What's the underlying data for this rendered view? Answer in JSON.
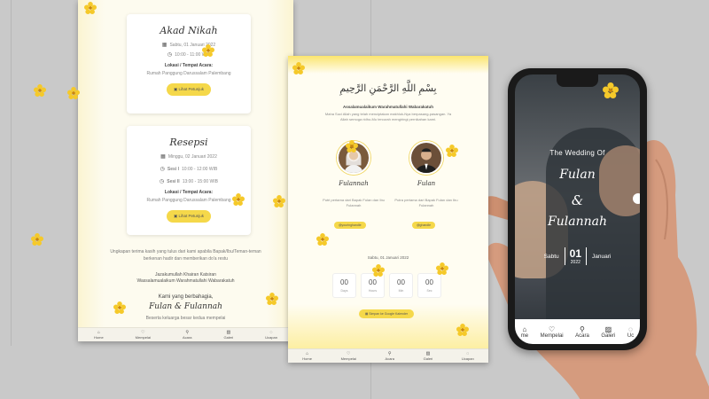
{
  "left": {
    "akad": {
      "title": "Akad Nikah",
      "date": "Sabtu, 01 Januari 2022",
      "time": "10:00 - 11:00 WIB",
      "venue_label": "Lokasi / Tempat Acara:",
      "venue": "Rumah Panggung Darussalam Palembang",
      "map_btn": "Lihat Petunjuk"
    },
    "resepsi": {
      "title": "Resepsi",
      "date": "Minggu, 02 Januari 2022",
      "sesi1_label": "Sesi I",
      "sesi1_time": "10:00 - 12:00 WIB",
      "sesi2_label": "Sesi II",
      "sesi2_time": "13:00 - 15:00 WIB",
      "venue_label": "Lokasi / Tempat Acara:",
      "venue": "Rumah Panggung Darussalam Palembang",
      "map_btn": "Lihat Petunjuk"
    },
    "closing_text": "Ungkapan terima kasih yang tulus dari kami apabila Bapak/Ibu/Teman-teman berkenan hadir dan memberikan do'a restu",
    "closing_salam_1": "Jazakumullah Khairan Katsiran",
    "closing_salam_2": "Wassalamualaikum Warahmatullahi Wabarakatuh",
    "we_are": "Kami yang berbahagia,",
    "couple": "Fulan & Fulannah",
    "families": "Beserta keluarga besar kedua mempelai",
    "nav": [
      "Home",
      "Mempelai",
      "Acara",
      "Galeri",
      "Ucapan"
    ]
  },
  "mid": {
    "arabic": "بِسْمِ اللَّهِ الرَّحْمَنِ الرَّحِيمِ",
    "salam": "Assalamualaikum Warahmatullahi Wabarakatuh",
    "desc": "Maha Suci Allah yang telah menciptakan makhluk-Nya berpasang-pasangan. Ya Allah semoga ridho-Mu tercurah mengiringi pernikahan kami.",
    "bride": {
      "name": "Fulannah",
      "info": "Putri pertama dari Bapak Fulan dan Ibu Fulannah",
      "ig": "@youringhandle"
    },
    "groom": {
      "name": "Fulan",
      "info": "Putra pertama dari Bapak Fulan dan Ibu Fulannah",
      "ig": "@ghandle"
    },
    "date": "Sabtu, 01 Januari 2022",
    "countdown": [
      {
        "num": "00",
        "label": "Days"
      },
      {
        "num": "00",
        "label": "Hours"
      },
      {
        "num": "00",
        "label": "Min"
      },
      {
        "num": "00",
        "label": "Sec"
      }
    ],
    "save_btn": "Simpan ke Google Kalender",
    "nav": [
      "Home",
      "Mempelai",
      "Acara",
      "Galeri",
      "Ucapan"
    ]
  },
  "phone": {
    "title": "The Wedding Of",
    "name1": "Fulan",
    "amp": "&",
    "name2": "Fulannah",
    "day_name": "Sabtu",
    "day": "01",
    "year": "2022",
    "month": "Januari",
    "nav": [
      "me",
      "Mempelai",
      "Acara",
      "Galeri",
      "Uc"
    ]
  },
  "colors": {
    "accent": "#f5d84a",
    "cream": "#fdfbef",
    "bg": "#c9c9c9"
  }
}
